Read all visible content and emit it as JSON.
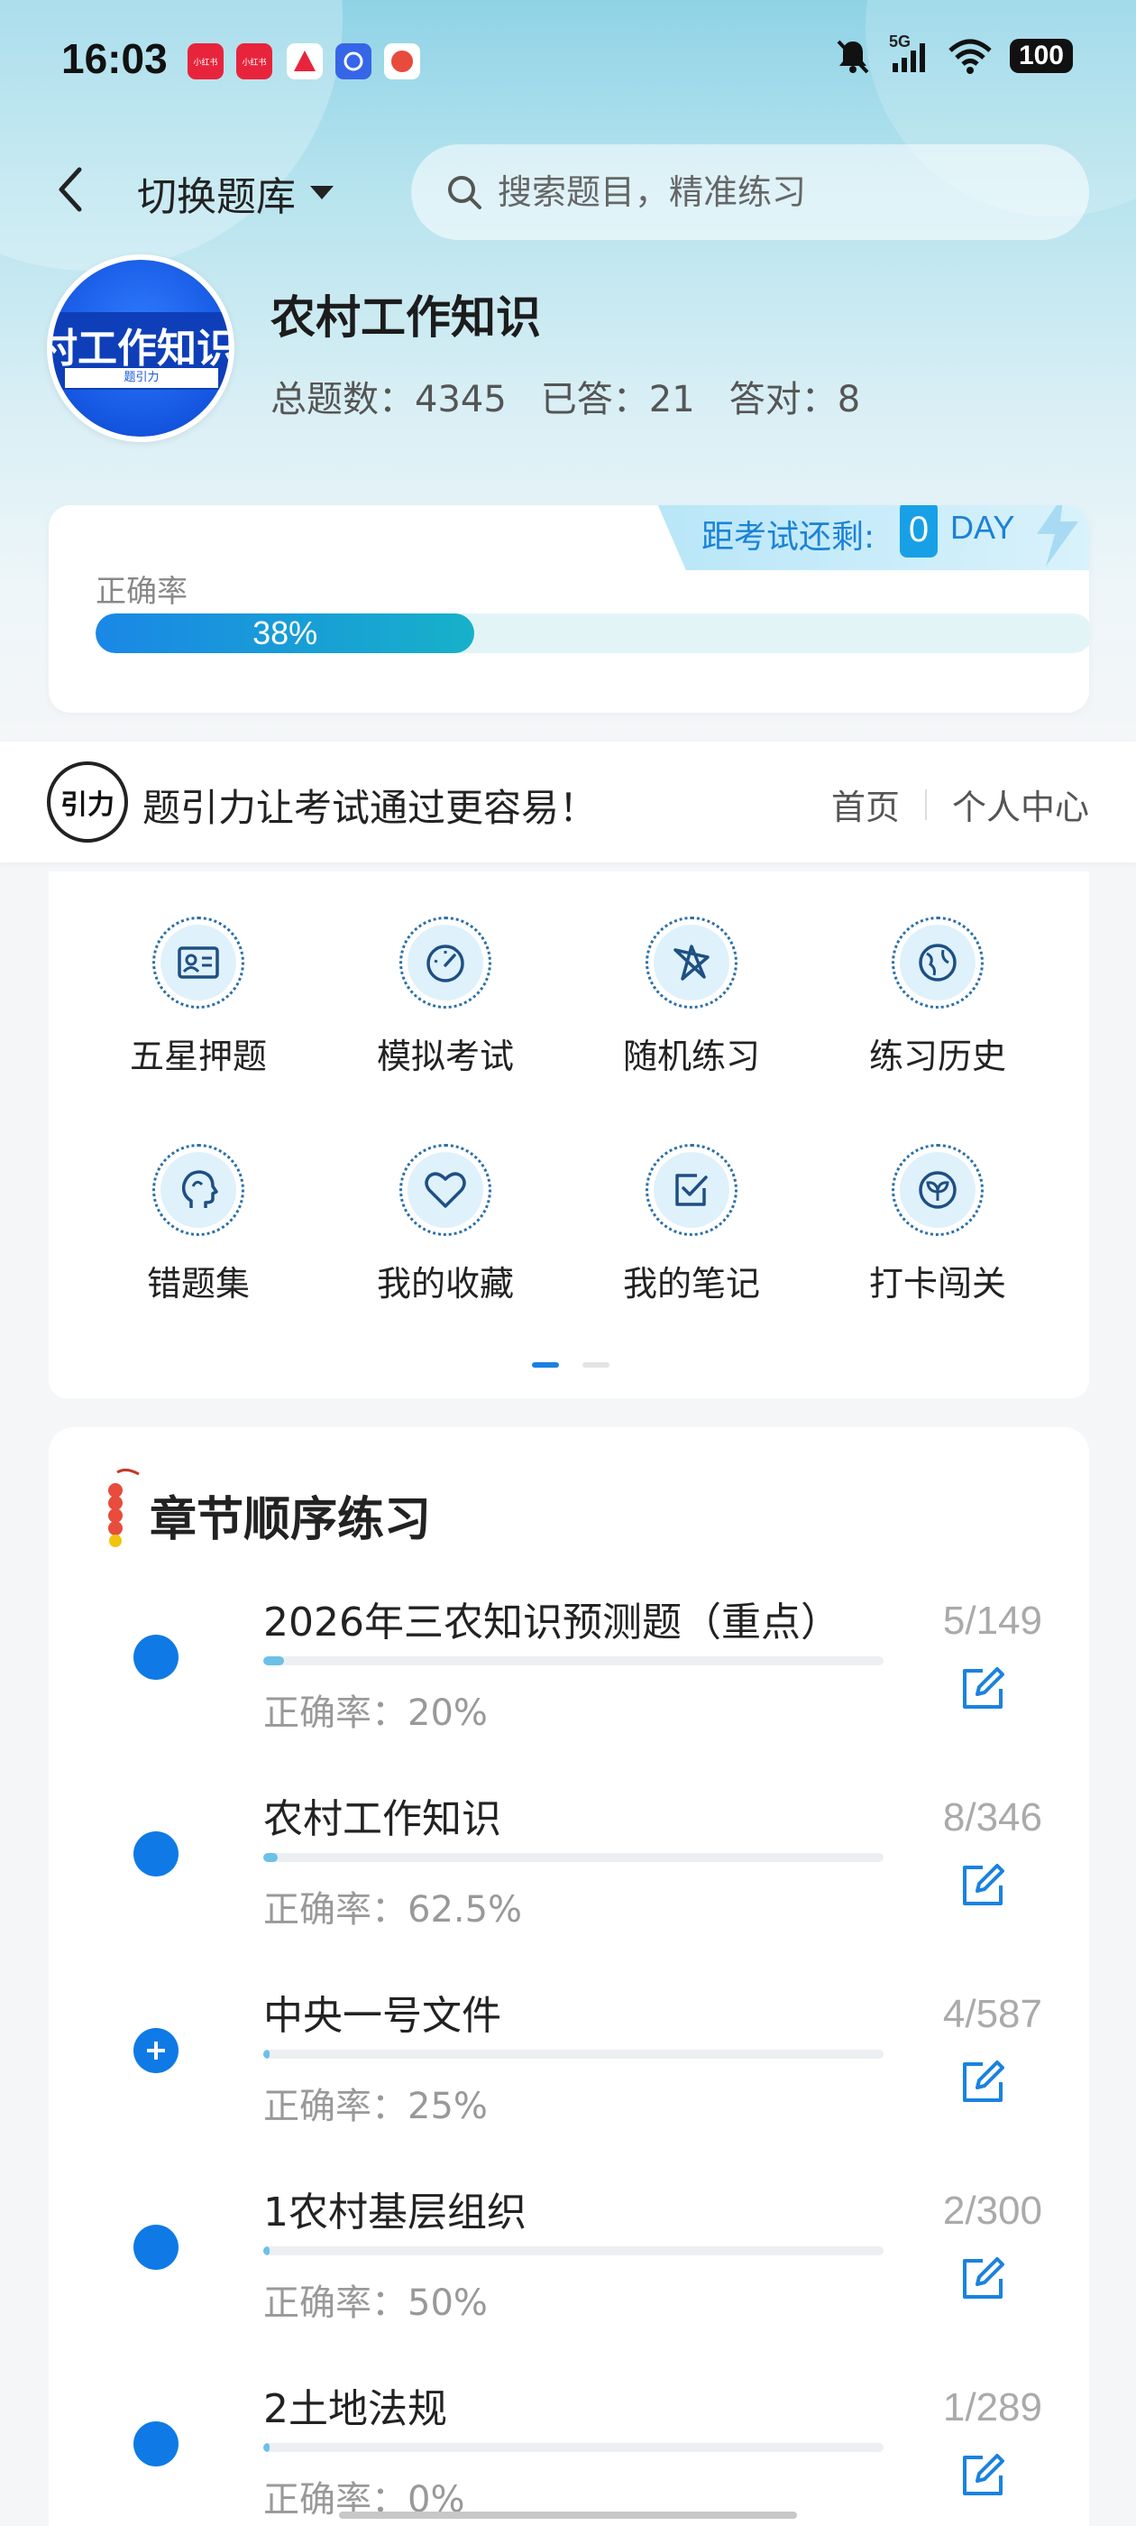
{
  "status_bar": {
    "time": "16:03",
    "notif_apps": [
      "小红书",
      "小红书",
      "",
      "",
      ""
    ],
    "network": "5G",
    "battery": "100"
  },
  "header": {
    "switch_label": "切换题库",
    "search_placeholder": "搜索题目，精准练习"
  },
  "bank": {
    "logo_text": "村工作知识",
    "logo_sub": "题引力",
    "title": "农村工作知识",
    "stats": {
      "total_label": "总题数：4345",
      "answered_label": "已答：21",
      "correct_label": "答对：8"
    }
  },
  "accuracy": {
    "label": "正确率",
    "percent_text": "38%",
    "percent": 38,
    "countdown_label": "距考试还剩:",
    "countdown_days": "0",
    "countdown_unit": "DAY"
  },
  "promo": {
    "logo_text": "引力",
    "text": "题引力让考试通过更容易！",
    "nav_home": "首页",
    "nav_profile": "个人中心"
  },
  "quick": [
    {
      "label": "五星押题",
      "icon": "id-card-icon"
    },
    {
      "label": "模拟考试",
      "icon": "speedometer-icon"
    },
    {
      "label": "随机练习",
      "icon": "random-star-icon"
    },
    {
      "label": "练习历史",
      "icon": "globe-icon"
    },
    {
      "label": "错题集",
      "icon": "head-icon"
    },
    {
      "label": "我的收藏",
      "icon": "heart-icon"
    },
    {
      "label": "我的笔记",
      "icon": "checkbox-icon"
    },
    {
      "label": "打卡闯关",
      "icon": "sprout-icon"
    }
  ],
  "chapters": {
    "title": "章节顺序练习",
    "items": [
      {
        "name": "2026年三农知识预测题（重点）",
        "accuracy": "正确率：20%",
        "count": "5/149",
        "progress": 0.034,
        "expandable": false
      },
      {
        "name": "农村工作知识",
        "accuracy": "正确率：62.5%",
        "count": "8/346",
        "progress": 0.023,
        "expandable": false
      },
      {
        "name": "中央一号文件",
        "accuracy": "正确率：25%",
        "count": "4/587",
        "progress": 0.007,
        "expandable": true
      },
      {
        "name": "1农村基层组织",
        "accuracy": "正确率：50%",
        "count": "2/300",
        "progress": 0.007,
        "expandable": false
      },
      {
        "name": "2土地法规",
        "accuracy": "正确率：0%",
        "count": "1/289",
        "progress": 0.003,
        "expandable": false
      }
    ]
  },
  "colors": {
    "accent": "#0f7ae5",
    "progress_start": "#1a87e6",
    "progress_end": "#17b1c9"
  }
}
